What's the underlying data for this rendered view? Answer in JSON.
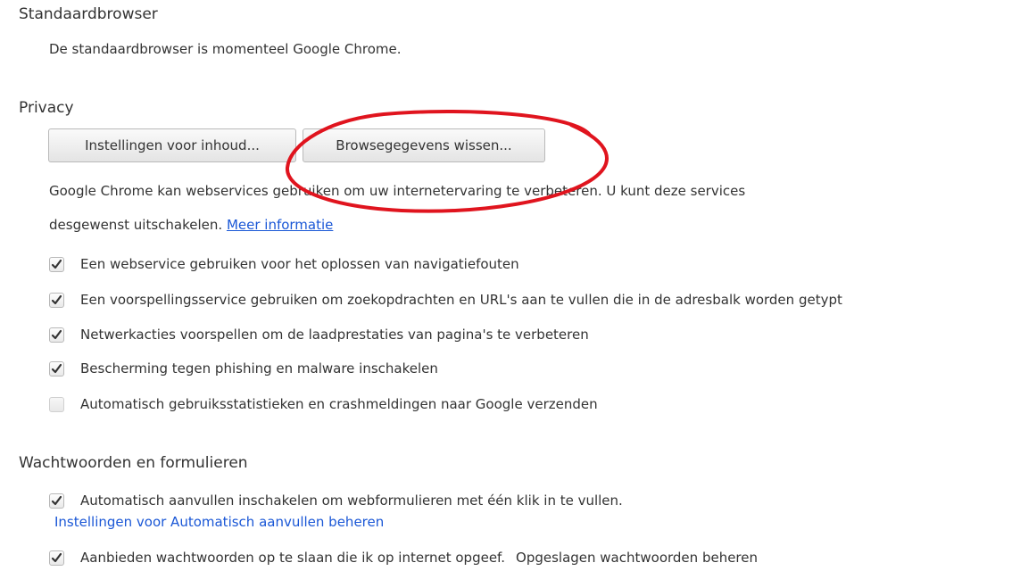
{
  "default_browser": {
    "title": "Standaardbrowser",
    "status": "De standaardbrowser is momenteel Google Chrome."
  },
  "privacy": {
    "title": "Privacy",
    "content_settings_button": "Instellingen voor inhoud...",
    "clear_data_button": "Browsegegevens wissen...",
    "description_line1": "Google Chrome kan webservices gebruiken om uw internetervaring te verbeteren. U kunt deze services",
    "description_line2": "desgewenst uitschakelen.",
    "more_info_link": "Meer informatie",
    "options": [
      {
        "label": "Een webservice gebruiken voor het oplossen van navigatiefouten",
        "checked": true
      },
      {
        "label": "Een voorspellingsservice gebruiken om zoekopdrachten en URL's aan te vullen die in de adresbalk worden getypt",
        "checked": true
      },
      {
        "label": "Netwerkacties voorspellen om de laadprestaties van pagina's te verbeteren",
        "checked": true
      },
      {
        "label": "Bescherming tegen phishing en malware inschakelen",
        "checked": true
      },
      {
        "label": "Automatisch gebruiksstatistieken en crashmeldingen naar Google verzenden",
        "checked": false
      }
    ]
  },
  "passwords": {
    "title": "Wachtwoorden en formulieren",
    "autofill_label": "Automatisch aanvullen inschakelen om webformulieren met één klik in te vullen.",
    "autofill_checked": true,
    "autofill_settings_link": "Instellingen voor Automatisch aanvullen beheren",
    "save_passwords_label": "Aanbieden wachtwoorden op te slaan die ik op internet opgeef.",
    "save_passwords_checked": true,
    "manage_passwords_link": "Opgeslagen wachtwoorden beheren"
  },
  "colors": {
    "link": "#1a57d6",
    "annotation": "#e0141e"
  },
  "icons": {
    "checkbox_mark": "checkmark-icon"
  }
}
